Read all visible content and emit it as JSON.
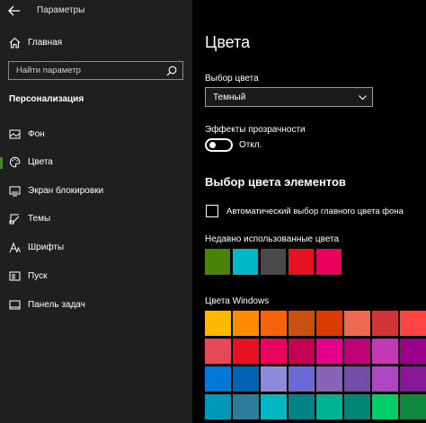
{
  "window": {
    "title": "Параметры"
  },
  "sidebar": {
    "home": "Главная",
    "search_placeholder": "Найти параметр",
    "section": "Персонализация",
    "items": [
      {
        "label": "Фон",
        "icon": "image-icon"
      },
      {
        "label": "Цвета",
        "icon": "palette-icon",
        "selected": true
      },
      {
        "label": "Экран блокировки",
        "icon": "lock-screen-icon"
      },
      {
        "label": "Темы",
        "icon": "theme-icon"
      },
      {
        "label": "Шрифты",
        "icon": "font-icon"
      },
      {
        "label": "Пуск",
        "icon": "start-icon"
      },
      {
        "label": "Панель задач",
        "icon": "taskbar-icon"
      }
    ]
  },
  "main": {
    "title": "Цвета",
    "color_choice_label": "Выбор цвета",
    "color_choice_value": "Темный",
    "transparency_label": "Эффекты прозрачности",
    "transparency_state": "Откл.",
    "accent_heading": "Выбор цвета элементов",
    "auto_accent_label": "Автоматический выбор главного цвета фона",
    "recent_label": "Недавно использованные цвета",
    "recent_colors": [
      "#498205",
      "#00b7c3",
      "#4c4a48",
      "#e81123",
      "#ea005e"
    ],
    "windows_colors_label": "Цвета Windows",
    "windows_colors": [
      [
        "#ffb900",
        "#ff8c00",
        "#f7630c",
        "#ca5010",
        "#da3b01",
        "#ef6950",
        "#d13438",
        "#ff4343"
      ],
      [
        "#e74856",
        "#e81123",
        "#ea005e",
        "#c30052",
        "#e3008c",
        "#bf0077",
        "#c239b3",
        "#9a0089"
      ],
      [
        "#0078d7",
        "#0063b1",
        "#8e8cd8",
        "#6b69d6",
        "#8764b8",
        "#744da9",
        "#b146c2",
        "#881798"
      ],
      [
        "#0099bc",
        "#2d7d9a",
        "#00b7c3",
        "#038387",
        "#00b294",
        "#018574",
        "#00cc6a",
        "#10893e"
      ]
    ]
  },
  "accent_color": "#3f8f20"
}
